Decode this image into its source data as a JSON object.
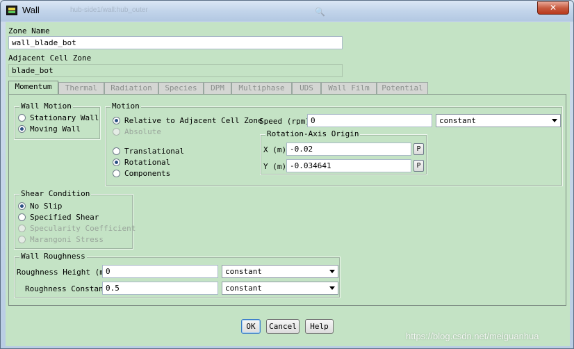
{
  "window": {
    "title": "Wall",
    "close_label": "✕",
    "title_ghost_text": "hub-side1/wall:hub_outer"
  },
  "zone_name": {
    "label": "Zone Name",
    "value": "wall_blade_bot"
  },
  "adjacent_cell_zone": {
    "label": "Adjacent Cell Zone",
    "value": "blade_bot"
  },
  "tabs": [
    {
      "label": "Momentum",
      "active": true
    },
    {
      "label": "Thermal"
    },
    {
      "label": "Radiation"
    },
    {
      "label": "Species"
    },
    {
      "label": "DPM"
    },
    {
      "label": "Multiphase"
    },
    {
      "label": "UDS"
    },
    {
      "label": "Wall Film"
    },
    {
      "label": "Potential"
    }
  ],
  "wall_motion": {
    "title": "Wall Motion",
    "options": [
      "Stationary Wall",
      "Moving Wall"
    ],
    "selected": "Moving Wall"
  },
  "motion": {
    "title": "Motion",
    "relative": "Relative to Adjacent Cell Zone",
    "absolute": "Absolute",
    "translational": "Translational",
    "rotational": "Rotational",
    "components": "Components",
    "speed_label": "Speed (rpm)",
    "speed_value": "0",
    "speed_profile": "constant",
    "rotation_axis_origin": {
      "title": "Rotation-Axis Origin",
      "x_label": "X (m)",
      "x_value": "-0.02",
      "y_label": "Y (m)",
      "y_value": "-0.034641",
      "p_label": "P"
    }
  },
  "shear_condition": {
    "title": "Shear Condition",
    "options": [
      "No Slip",
      "Specified Shear",
      "Specularity Coefficient",
      "Marangoni Stress"
    ],
    "selected": "No Slip"
  },
  "wall_roughness": {
    "title": "Wall Roughness",
    "height_label": "Roughness Height (m)",
    "height_value": "0",
    "height_profile": "constant",
    "constant_label": "Roughness Constant",
    "constant_value": "0.5",
    "constant_profile": "constant"
  },
  "buttons": {
    "ok": "OK",
    "cancel": "Cancel",
    "help": "Help"
  },
  "watermark": "https://blog.csdn.net/meiguanhua"
}
